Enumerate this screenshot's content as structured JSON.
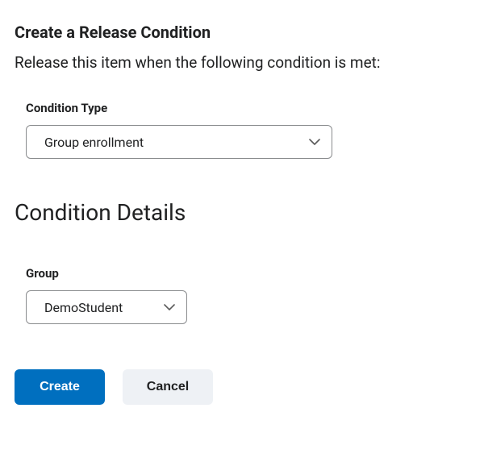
{
  "header": {
    "title": "Create a Release Condition",
    "description": "Release this item when the following condition is met:"
  },
  "conditionType": {
    "label": "Condition Type",
    "value": "Group enrollment"
  },
  "details": {
    "title": "Condition Details",
    "group": {
      "label": "Group",
      "value": "DemoStudent"
    }
  },
  "buttons": {
    "create": "Create",
    "cancel": "Cancel"
  }
}
